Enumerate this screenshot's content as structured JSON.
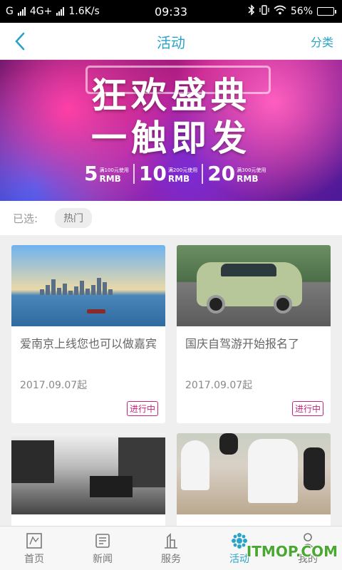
{
  "status_bar": {
    "carrier_left": "G",
    "network": "4G+",
    "speed": "1.6K/s",
    "time": "09:33",
    "battery_percent": "56%",
    "battery_level": 0.56
  },
  "header": {
    "back_icon": "chevron-left-icon",
    "title": "活动",
    "category_label": "分类"
  },
  "banner": {
    "line1": "狂欢盛典",
    "line2": "一触即发",
    "coupons": [
      {
        "value": "5",
        "unit": "RMB",
        "condition": "满100元使用"
      },
      {
        "value": "10",
        "unit": "RMB",
        "condition": "满200元使用"
      },
      {
        "value": "20",
        "unit": "RMB",
        "condition": "满300元使用"
      }
    ]
  },
  "filter": {
    "label": "已选:",
    "tag": "热门"
  },
  "cards": [
    {
      "title": "爱南京上线您也可以做嘉宾",
      "date": "2017.09.07起",
      "status": "进行中"
    },
    {
      "title": "国庆自驾游开始报名了",
      "date": "2017.09.07起",
      "status": "进行中"
    },
    {
      "title": "",
      "date": "",
      "status": ""
    },
    {
      "title": "",
      "date": "",
      "status": ""
    }
  ],
  "nav": [
    {
      "label": "首页",
      "icon": "home-map-icon"
    },
    {
      "label": "新闻",
      "icon": "news-icon"
    },
    {
      "label": "服务",
      "icon": "service-icon"
    },
    {
      "label": "活动",
      "icon": "activity-icon",
      "active": true
    },
    {
      "label": "我的",
      "icon": "profile-icon"
    }
  ],
  "watermark": "ITMOP.COM",
  "colors": {
    "accent": "#2aa3c8",
    "status_tag": "#c2267c"
  }
}
